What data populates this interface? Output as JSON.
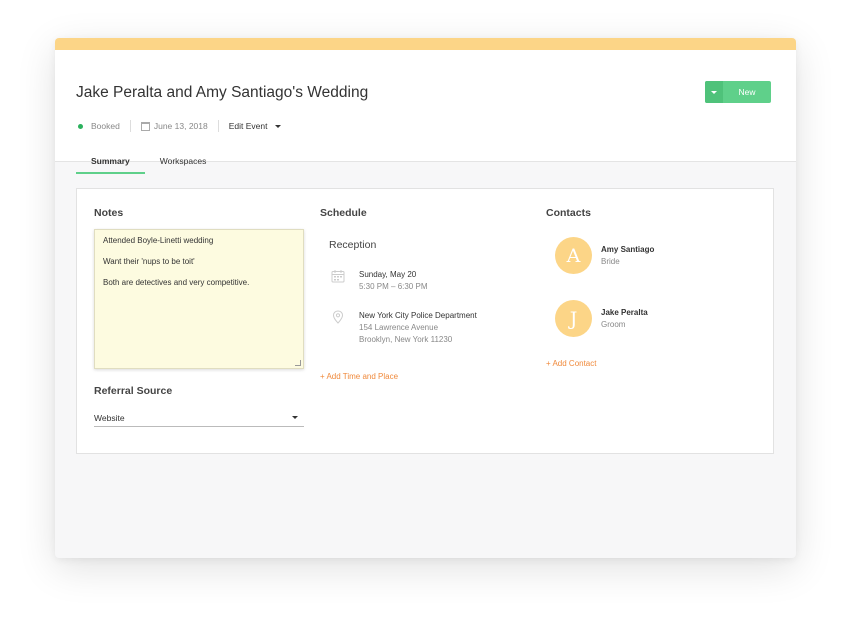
{
  "event": {
    "title": "Jake Peralta and Amy Santiago's Wedding",
    "status": "Booked",
    "date": "June 13, 2018",
    "edit_label": "Edit Event"
  },
  "toolbar": {
    "new_label": "New"
  },
  "tabs": [
    {
      "label": "Summary",
      "active": true
    },
    {
      "label": "Workspaces",
      "active": false
    }
  ],
  "notes": {
    "title": "Notes",
    "lines": [
      "Attended Boyle-Linetti wedding",
      "Want their 'nups to be toit'",
      "Both are detectives and very competitive."
    ]
  },
  "referral": {
    "title": "Referral Source",
    "value": "Website"
  },
  "schedule": {
    "title": "Schedule",
    "item_title": "Reception",
    "date": "Sunday, May 20",
    "time": "5:30 PM – 6:30 PM",
    "place": "New York City Police Department",
    "address1": "154 Lawrence Avenue",
    "address2": "Brooklyn, New York 11230",
    "add_label": "+ Add Time and Place"
  },
  "contacts": {
    "title": "Contacts",
    "items": [
      {
        "initial": "A",
        "name": "Amy Santiago",
        "role": "Bride"
      },
      {
        "initial": "J",
        "name": "Jake Peralta",
        "role": "Groom"
      }
    ],
    "add_label": "+ Add Contact"
  },
  "colors": {
    "accent_green": "#5fd08a",
    "banner_yellow": "#fcd587",
    "link_orange": "#f08a3c"
  }
}
